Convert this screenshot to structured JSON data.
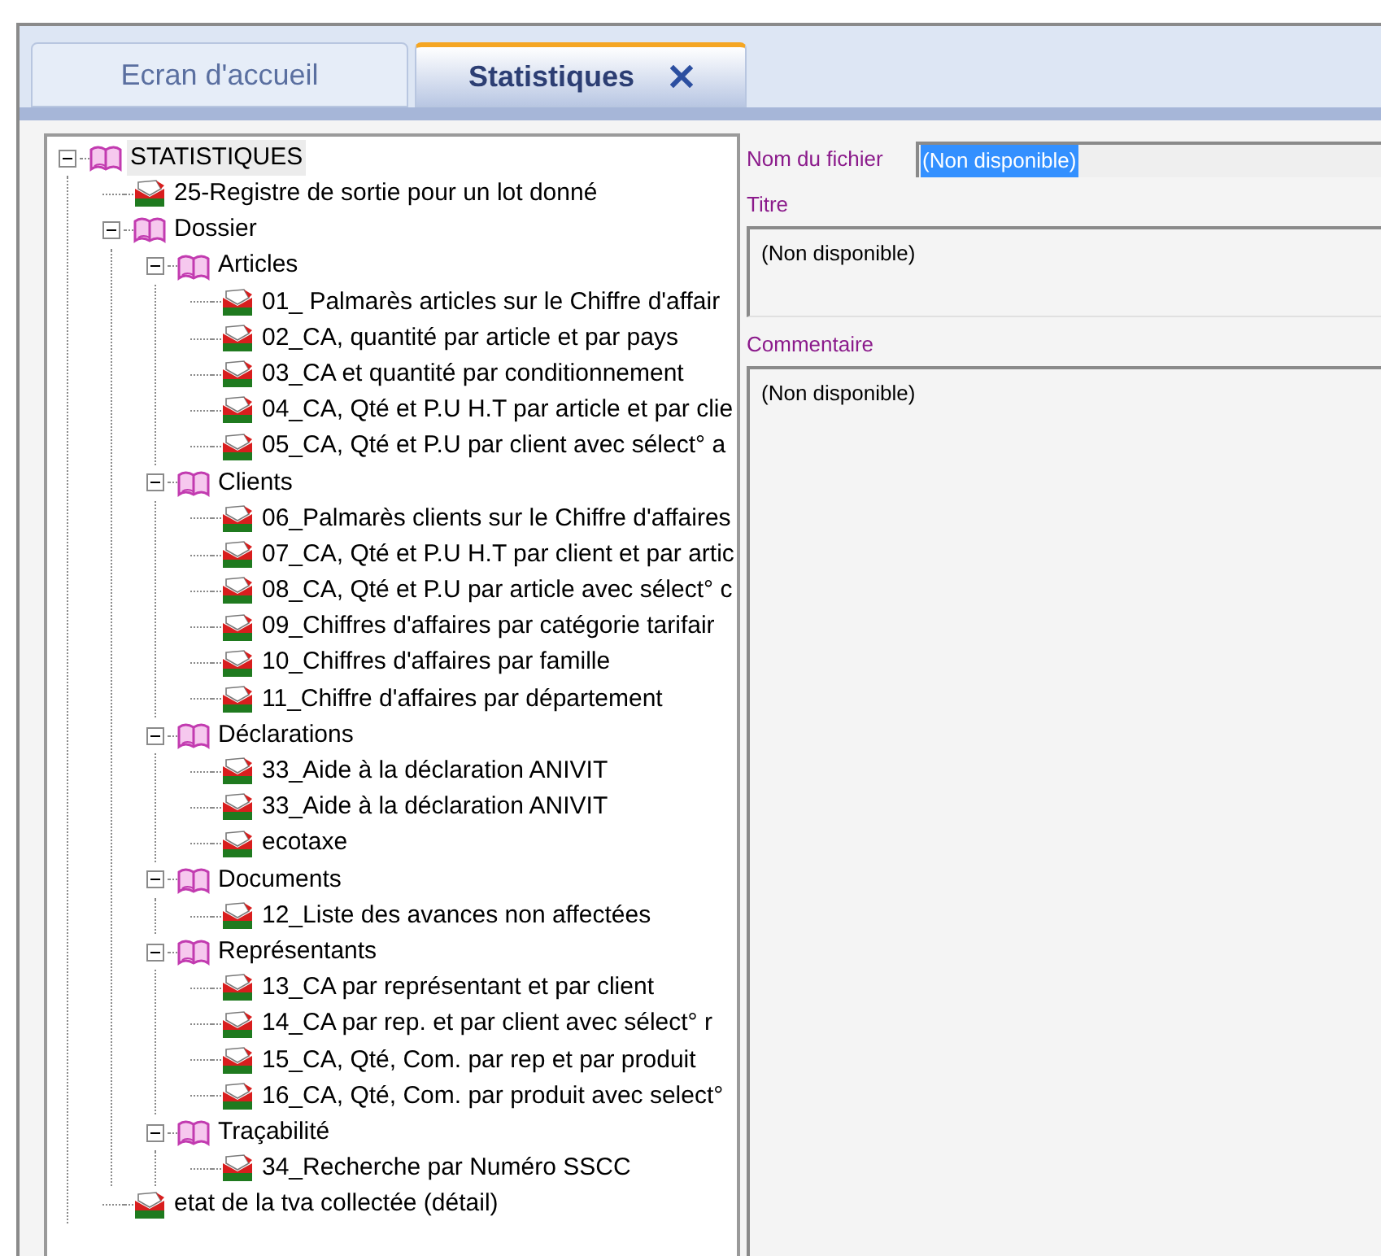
{
  "tabs": [
    {
      "label": "Ecran d'accueil",
      "selected": false,
      "closable": false
    },
    {
      "label": "Statistiques",
      "selected": true,
      "closable": true
    }
  ],
  "tree": [
    {
      "kind": "folder",
      "label": "STATISTIQUES",
      "expanded": true,
      "selected": true,
      "children": [
        {
          "kind": "report",
          "label": "25-Registre de sortie pour un lot donné",
          "selected": false
        },
        {
          "kind": "folder",
          "label": "Dossier",
          "expanded": true,
          "selected": false,
          "children": [
            {
              "kind": "folder",
              "label": "Articles",
              "expanded": true,
              "selected": false,
              "children": [
                {
                  "kind": "report",
                  "label": "01_ Palmarès articles sur le Chiffre d'affair",
                  "selected": false
                },
                {
                  "kind": "report",
                  "label": "02_CA, quantité par article et par pays",
                  "selected": false
                },
                {
                  "kind": "report",
                  "label": "03_CA et quantité par conditionnement",
                  "selected": false
                },
                {
                  "kind": "report",
                  "label": "04_CA, Qté et P.U H.T par article et par clie",
                  "selected": false
                },
                {
                  "kind": "report",
                  "label": "05_CA, Qté et P.U par client avec sélect° a",
                  "selected": false
                }
              ]
            },
            {
              "kind": "folder",
              "label": "Clients",
              "expanded": true,
              "selected": false,
              "children": [
                {
                  "kind": "report",
                  "label": "06_Palmarès clients sur le Chiffre d'affaires",
                  "selected": false
                },
                {
                  "kind": "report",
                  "label": "07_CA, Qté et P.U H.T par client et par artic",
                  "selected": false
                },
                {
                  "kind": "report",
                  "label": "08_CA, Qté et P.U par article avec sélect° c",
                  "selected": false
                },
                {
                  "kind": "report",
                  "label": "09_Chiffres d'affaires par catégorie tarifair",
                  "selected": false
                },
                {
                  "kind": "report",
                  "label": "10_Chiffres d'affaires par famille",
                  "selected": false
                },
                {
                  "kind": "report",
                  "label": "11_Chiffre d'affaires par département",
                  "selected": false
                }
              ]
            },
            {
              "kind": "folder",
              "label": "Déclarations",
              "expanded": true,
              "selected": false,
              "children": [
                {
                  "kind": "report",
                  "label": "33_Aide à la déclaration ANIVIT",
                  "selected": false
                },
                {
                  "kind": "report",
                  "label": "33_Aide à la déclaration ANIVIT",
                  "selected": false
                },
                {
                  "kind": "report",
                  "label": "ecotaxe",
                  "selected": false
                }
              ]
            },
            {
              "kind": "folder",
              "label": "Documents",
              "expanded": true,
              "selected": false,
              "children": [
                {
                  "kind": "report",
                  "label": "12_Liste des avances non affectées",
                  "selected": false
                }
              ]
            },
            {
              "kind": "folder",
              "label": "Représentants",
              "expanded": true,
              "selected": false,
              "children": [
                {
                  "kind": "report",
                  "label": "13_CA par représentant et par client",
                  "selected": false
                },
                {
                  "kind": "report",
                  "label": "14_CA par rep. et  par client avec sélect° r",
                  "selected": false
                },
                {
                  "kind": "report",
                  "label": "15_CA, Qté, Com. par rep et par produit",
                  "selected": false
                },
                {
                  "kind": "report",
                  "label": "16_CA, Qté, Com. par produit avec select°",
                  "selected": false
                }
              ]
            },
            {
              "kind": "folder",
              "label": "Traçabilité",
              "expanded": true,
              "selected": false,
              "children": [
                {
                  "kind": "report",
                  "label": "34_Recherche par Numéro SSCC",
                  "selected": false
                }
              ]
            }
          ]
        },
        {
          "kind": "report",
          "label": "etat de la tva collectée (détail)",
          "selected": false
        }
      ]
    }
  ],
  "details": {
    "file_name": {
      "label": "Nom du fichier",
      "value": "(Non disponible)"
    },
    "title": {
      "label": "Titre",
      "value": "(Non disponible)"
    },
    "comment": {
      "label": "Commentaire",
      "value": "(Non disponible)"
    }
  }
}
